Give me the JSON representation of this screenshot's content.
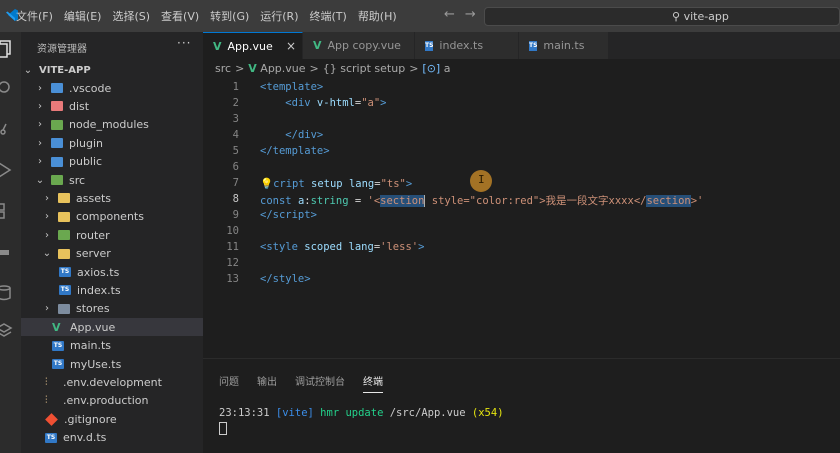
{
  "menu": [
    "文件(F)",
    "编辑(E)",
    "选择(S)",
    "查看(V)",
    "转到(G)",
    "运行(R)",
    "终端(T)",
    "帮助(H)"
  ],
  "search": {
    "label": "vite-app"
  },
  "sidebar": {
    "title": "资源管理器",
    "more": "···",
    "root": "VITE-APP",
    "items": [
      {
        "label": ".vscode",
        "depth": 1,
        "chevron": "›",
        "icon": "vscode-folder-icon",
        "color": "#4a8fd6"
      },
      {
        "label": "dist",
        "depth": 1,
        "chevron": "›",
        "icon": "dist-folder-icon",
        "color": "#e97a7a"
      },
      {
        "label": "node_modules",
        "depth": 1,
        "chevron": "›",
        "icon": "node-modules-folder-icon",
        "color": "#6aa84f"
      },
      {
        "label": "plugin",
        "depth": 1,
        "chevron": "›",
        "icon": "plugin-folder-icon",
        "color": "#4a8fd6"
      },
      {
        "label": "public",
        "depth": 1,
        "chevron": "›",
        "icon": "public-folder-icon",
        "color": "#4a8fd6"
      },
      {
        "label": "src",
        "depth": 1,
        "chevron": "⌄",
        "icon": "src-folder-icon",
        "color": "#6aa84f"
      },
      {
        "label": "assets",
        "depth": 2,
        "chevron": "›",
        "icon": "assets-folder-icon",
        "color": "#e8c25c"
      },
      {
        "label": "components",
        "depth": 2,
        "chevron": "›",
        "icon": "components-folder-icon",
        "color": "#e8c25c"
      },
      {
        "label": "router",
        "depth": 2,
        "chevron": "›",
        "icon": "router-folder-icon",
        "color": "#6aa84f"
      },
      {
        "label": "server",
        "depth": 2,
        "chevron": "⌄",
        "icon": "server-folder-icon",
        "color": "#e8c25c"
      },
      {
        "label": "axios.ts",
        "depth": 3,
        "chevron": "",
        "icon": "typescript-file-icon",
        "color": "#3178c6"
      },
      {
        "label": "index.ts",
        "depth": 3,
        "chevron": "",
        "icon": "typescript-file-icon",
        "color": "#3178c6"
      },
      {
        "label": "stores",
        "depth": 2,
        "chevron": "›",
        "icon": "stores-folder-icon",
        "color": "#7d8c9e"
      },
      {
        "label": "App.vue",
        "depth": 2,
        "chevron": "",
        "icon": "vue-file-icon",
        "color": "#41b883"
      },
      {
        "label": "main.ts",
        "depth": 2,
        "chevron": "",
        "icon": "typescript-file-icon",
        "color": "#3178c6"
      },
      {
        "label": "myUse.ts",
        "depth": 2,
        "chevron": "",
        "icon": "typescript-file-icon",
        "color": "#3178c6"
      },
      {
        "label": ".env.development",
        "depth": 1,
        "chevron": "",
        "icon": "env-file-icon",
        "color": "#e2c08d"
      },
      {
        "label": ".env.production",
        "depth": 1,
        "chevron": "",
        "icon": "env-file-icon",
        "color": "#e2c08d"
      },
      {
        "label": ".gitignore",
        "depth": 1,
        "chevron": "",
        "icon": "git-file-icon",
        "color": "#f05033"
      },
      {
        "label": "env.d.ts",
        "depth": 1,
        "chevron": "",
        "icon": "typescript-file-icon",
        "color": "#3178c6"
      }
    ]
  },
  "tabs": [
    {
      "label": "App.vue",
      "icon": "V",
      "active": true,
      "close": "×"
    },
    {
      "label": "App copy.vue",
      "icon": "V",
      "active": false
    },
    {
      "label": "index.ts",
      "icon": "TS",
      "active": false
    },
    {
      "label": "main.ts",
      "icon": "TS",
      "active": false
    }
  ],
  "breadcrumb": [
    "src",
    "App.vue",
    "{} script setup",
    "a"
  ],
  "editor": {
    "line_numbers": [
      "1",
      "2",
      "3",
      "4",
      "5",
      "6",
      "7",
      "8",
      "9",
      "10",
      "11",
      "12",
      "13"
    ]
  },
  "panel": {
    "tabs": [
      "问题",
      "输出",
      "调试控制台",
      "终端"
    ],
    "terminal": {
      "time": "23:13:31",
      "tag": "[vite]",
      "msg": "hmr update",
      "path": "/src/App.vue",
      "count": "(x54)"
    }
  }
}
